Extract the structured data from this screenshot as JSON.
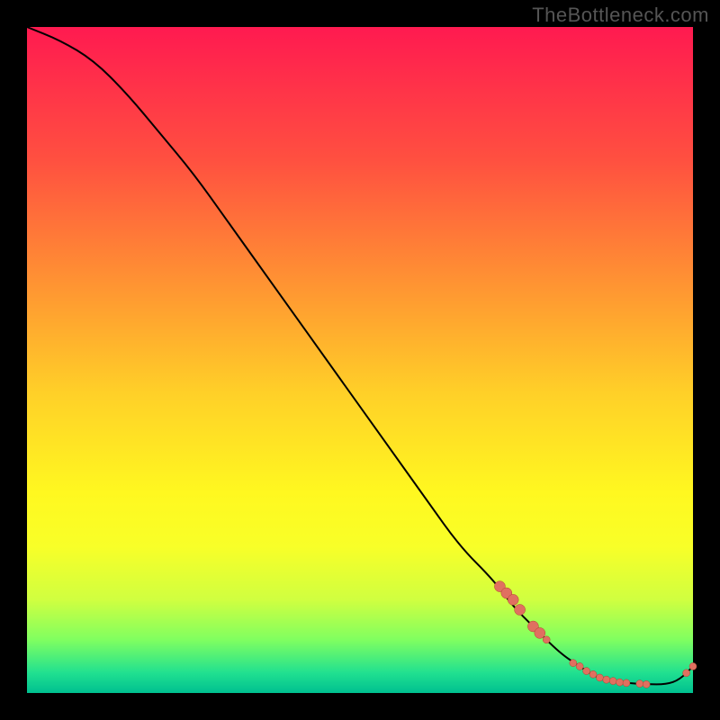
{
  "watermark": "TheBottleneck.com",
  "colors": {
    "marker_fill": "#e07060",
    "marker_stroke": "#b54030",
    "curve_stroke": "#000000"
  },
  "chart_data": {
    "type": "line",
    "title": "",
    "xlabel": "",
    "ylabel": "",
    "xlim": [
      0,
      100
    ],
    "ylim": [
      0,
      100
    ],
    "series": [
      {
        "name": "bottleneck-curve",
        "x": [
          0,
          5,
          10,
          15,
          20,
          25,
          30,
          35,
          40,
          45,
          50,
          55,
          60,
          65,
          70,
          73,
          76,
          80,
          83,
          86,
          90,
          93,
          96,
          98,
          100
        ],
        "y": [
          100,
          98,
          95,
          90,
          84,
          78,
          71,
          64,
          57,
          50,
          43,
          36,
          29,
          22,
          17,
          13,
          10,
          6,
          4,
          2,
          1.5,
          1.3,
          1.3,
          2,
          4
        ]
      }
    ],
    "markers": {
      "series": "bottleneck-curve",
      "points": [
        {
          "x": 71,
          "y": 16
        },
        {
          "x": 72,
          "y": 15
        },
        {
          "x": 73,
          "y": 14
        },
        {
          "x": 74,
          "y": 12.5
        },
        {
          "x": 76,
          "y": 10
        },
        {
          "x": 77,
          "y": 9
        },
        {
          "x": 78,
          "y": 8
        },
        {
          "x": 82,
          "y": 4.5
        },
        {
          "x": 83,
          "y": 4
        },
        {
          "x": 84,
          "y": 3.3
        },
        {
          "x": 85,
          "y": 2.8
        },
        {
          "x": 86,
          "y": 2.3
        },
        {
          "x": 87,
          "y": 2
        },
        {
          "x": 88,
          "y": 1.8
        },
        {
          "x": 89,
          "y": 1.6
        },
        {
          "x": 90,
          "y": 1.5
        },
        {
          "x": 92,
          "y": 1.4
        },
        {
          "x": 93,
          "y": 1.3
        },
        {
          "x": 99,
          "y": 3
        },
        {
          "x": 100,
          "y": 4
        }
      ],
      "radius_small": 4,
      "radius_large": 6
    },
    "annotations": []
  }
}
